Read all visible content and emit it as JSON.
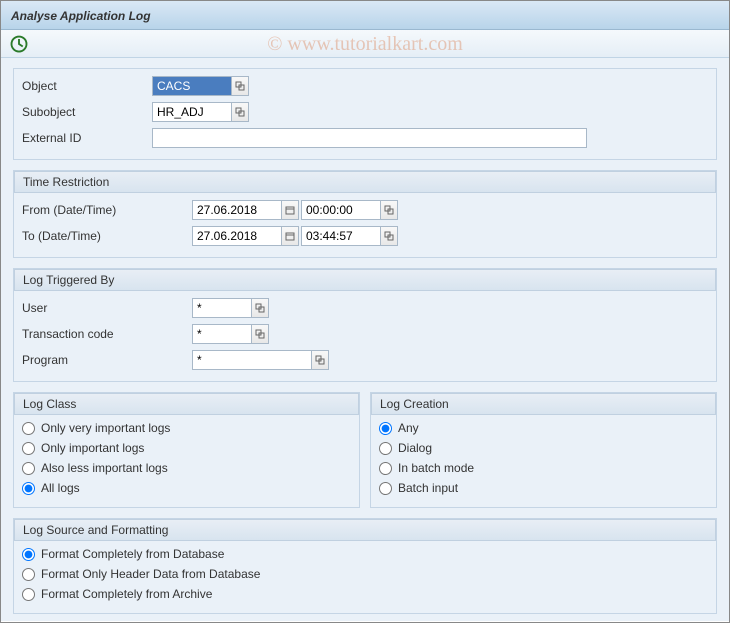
{
  "title": "Analyse Application Log",
  "watermark": "© www.tutorialkart.com",
  "fields": {
    "object": {
      "label": "Object",
      "value": "CACS"
    },
    "subobject": {
      "label": "Subobject",
      "value": "HR_ADJ"
    },
    "external_id": {
      "label": "External ID",
      "value": ""
    }
  },
  "time_restriction": {
    "title": "Time Restriction",
    "from": {
      "label": "From (Date/Time)",
      "date": "27.06.2018",
      "time": "00:00:00"
    },
    "to": {
      "label": "To (Date/Time)",
      "date": "27.06.2018",
      "time": "03:44:57"
    }
  },
  "log_triggered_by": {
    "title": "Log Triggered By",
    "user": {
      "label": "User",
      "value": "*"
    },
    "tcode": {
      "label": "Transaction code",
      "value": "*"
    },
    "program": {
      "label": "Program",
      "value": "*"
    }
  },
  "log_class": {
    "title": "Log Class",
    "options": [
      "Only very important logs",
      "Only important logs",
      "Also less important logs",
      "All logs"
    ],
    "selected": 3
  },
  "log_creation": {
    "title": "Log Creation",
    "options": [
      "Any",
      "Dialog",
      "In batch mode",
      "Batch input"
    ],
    "selected": 0
  },
  "log_source": {
    "title": "Log Source and Formatting",
    "options": [
      "Format Completely from Database",
      "Format Only Header Data from Database",
      "Format Completely from Archive"
    ],
    "selected": 0
  }
}
